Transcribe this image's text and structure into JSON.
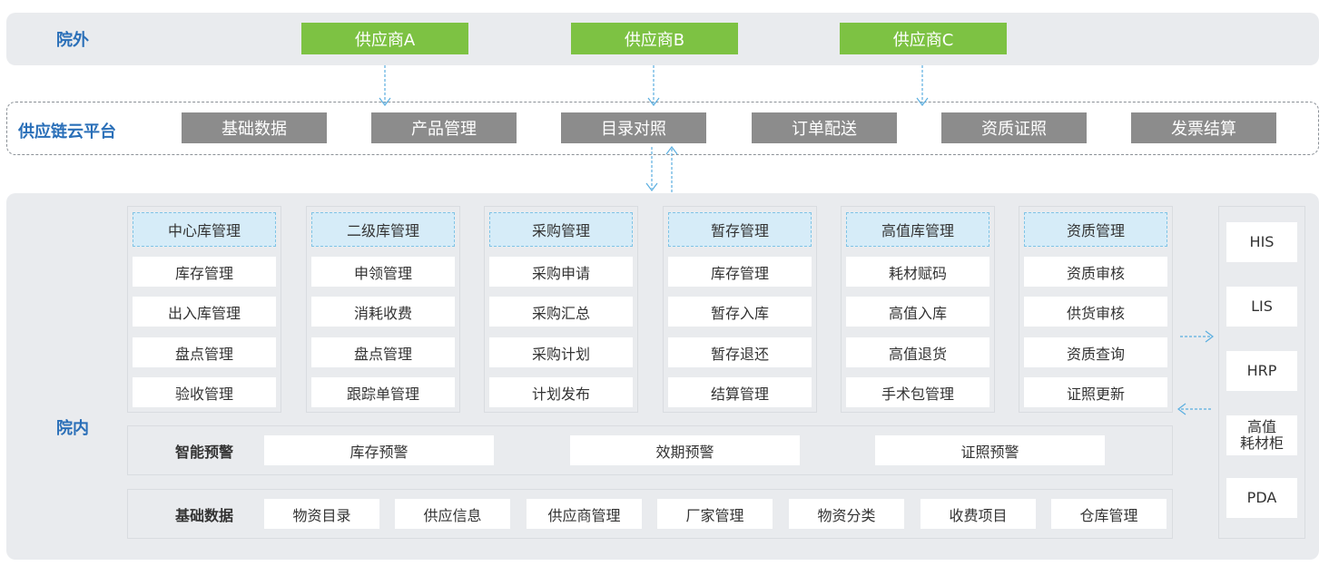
{
  "outside": {
    "label": "院外",
    "suppliers": [
      "供应商A",
      "供应商B",
      "供应商C"
    ]
  },
  "platform": {
    "label": "供应链云平台",
    "items": [
      "基础数据",
      "产品管理",
      "目录对照",
      "订单配送",
      "资质证照",
      "发票结算"
    ]
  },
  "inside": {
    "label": "院内",
    "modules": [
      {
        "title": "中心库管理",
        "items": [
          "库存管理",
          "出入库管理",
          "盘点管理",
          "验收管理"
        ]
      },
      {
        "title": "二级库管理",
        "items": [
          "申领管理",
          "消耗收费",
          "盘点管理",
          "跟踪单管理"
        ]
      },
      {
        "title": "采购管理",
        "items": [
          "采购申请",
          "采购汇总",
          "采购计划",
          "计划发布"
        ]
      },
      {
        "title": "暂存管理",
        "items": [
          "库存管理",
          "暂存入库",
          "暂存退还",
          "结算管理"
        ]
      },
      {
        "title": "高值库管理",
        "items": [
          "耗材赋码",
          "高值入库",
          "高值退货",
          "手术包管理"
        ]
      },
      {
        "title": "资质管理",
        "items": [
          "资质审核",
          "供货审核",
          "资质查询",
          "证照更新"
        ]
      }
    ],
    "warning": {
      "label": "智能预警",
      "items": [
        "库存预警",
        "效期预警",
        "证照预警"
      ]
    },
    "basic": {
      "label": "基础数据",
      "items": [
        "物资目录",
        "供应信息",
        "供应商管理",
        "厂家管理",
        "物资分类",
        "收费项目",
        "仓库管理"
      ]
    },
    "systems": [
      "HIS",
      "LIS",
      "HRP",
      "高值\n耗材柜",
      "PDA"
    ]
  },
  "colors": {
    "green": "#7dc243",
    "gray": "#8c8c8c",
    "blue_label": "#2a6fb8",
    "band": "#e9ebee",
    "arrow": "#5aaee0"
  }
}
